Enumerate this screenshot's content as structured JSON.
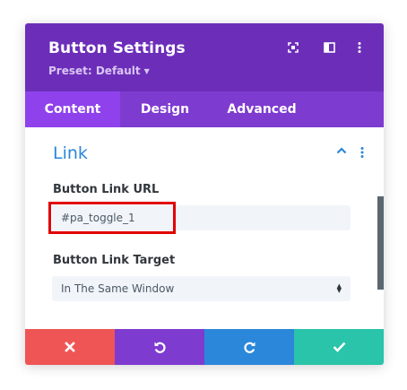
{
  "header": {
    "title": "Button Settings",
    "preset_label": "Preset: Default",
    "background": "#6c2eb9",
    "icons": [
      "expand-icon",
      "sidebar-icon",
      "more-vertical-icon"
    ]
  },
  "tabs": [
    {
      "label": "Content",
      "active": true
    },
    {
      "label": "Design",
      "active": false
    },
    {
      "label": "Advanced",
      "active": false
    }
  ],
  "section": {
    "title": "Link",
    "collapsed": false
  },
  "fields": {
    "url_label": "Button Link URL",
    "url_value": "#pa_toggle_1",
    "target_label": "Button Link Target",
    "target_value": "In The Same Window"
  },
  "footer": {
    "buttons": [
      {
        "name": "cancel",
        "icon": "close-icon",
        "color": "#ef5555"
      },
      {
        "name": "undo",
        "icon": "undo-icon",
        "color": "#7e3bd0"
      },
      {
        "name": "redo",
        "icon": "redo-icon",
        "color": "#2b87da"
      },
      {
        "name": "save",
        "icon": "check-icon",
        "color": "#29c4a9"
      }
    ]
  },
  "colors": {
    "accent": "#2b87da",
    "highlight_box": "#e00000"
  }
}
